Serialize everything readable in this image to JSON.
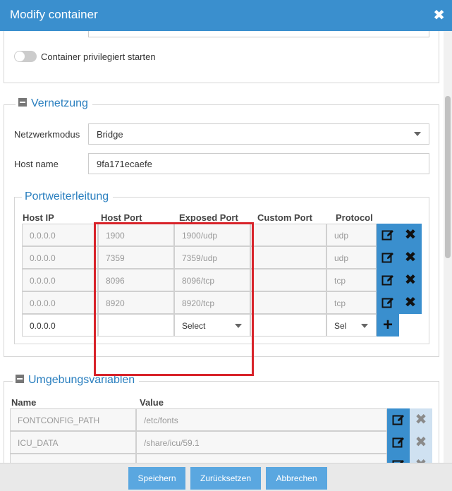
{
  "dialog": {
    "title": "Modify container",
    "close_icon": "✖"
  },
  "general": {
    "toggle_label": "Container privilegiert starten"
  },
  "network": {
    "legend": "Vernetzung",
    "mode_label": "Netzwerkmodus",
    "mode_value": "Bridge",
    "hostname_label": "Host name",
    "hostname_value": "9fa171ecaefe"
  },
  "ports": {
    "legend": "Portweiterleitung",
    "headers": {
      "host_ip": "Host IP",
      "host_port": "Host Port",
      "exposed_port": "Exposed Port",
      "custom_port": "Custom Port",
      "protocol": "Protocol"
    },
    "rows": [
      {
        "host_ip": "0.0.0.0",
        "host_port": "1900",
        "exposed_port": "1900/udp",
        "custom_port": "",
        "protocol": "udp"
      },
      {
        "host_ip": "0.0.0.0",
        "host_port": "7359",
        "exposed_port": "7359/udp",
        "custom_port": "",
        "protocol": "udp"
      },
      {
        "host_ip": "0.0.0.0",
        "host_port": "8096",
        "exposed_port": "8096/tcp",
        "custom_port": "",
        "protocol": "tcp"
      },
      {
        "host_ip": "0.0.0.0",
        "host_port": "8920",
        "exposed_port": "8920/tcp",
        "custom_port": "",
        "protocol": "tcp"
      }
    ],
    "new_row": {
      "host_ip": "0.0.0.0",
      "host_port": "",
      "exposed_port": "Select",
      "custom_port": "",
      "protocol": "Sel"
    }
  },
  "env": {
    "legend": "Umgebungsvariablen",
    "headers": {
      "name": "Name",
      "value": "Value"
    },
    "rows": [
      {
        "name": "FONTCONFIG_PATH",
        "value": "/etc/fonts"
      },
      {
        "name": "ICU_DATA",
        "value": "/share/icu/59.1"
      }
    ]
  },
  "footer": {
    "save": "Speichern",
    "reset": "Zurücksetzen",
    "cancel": "Abbrechen"
  },
  "colors": {
    "primary": "#3a8fce",
    "highlight": "#d8232a",
    "legend": "#2a7fbf"
  }
}
